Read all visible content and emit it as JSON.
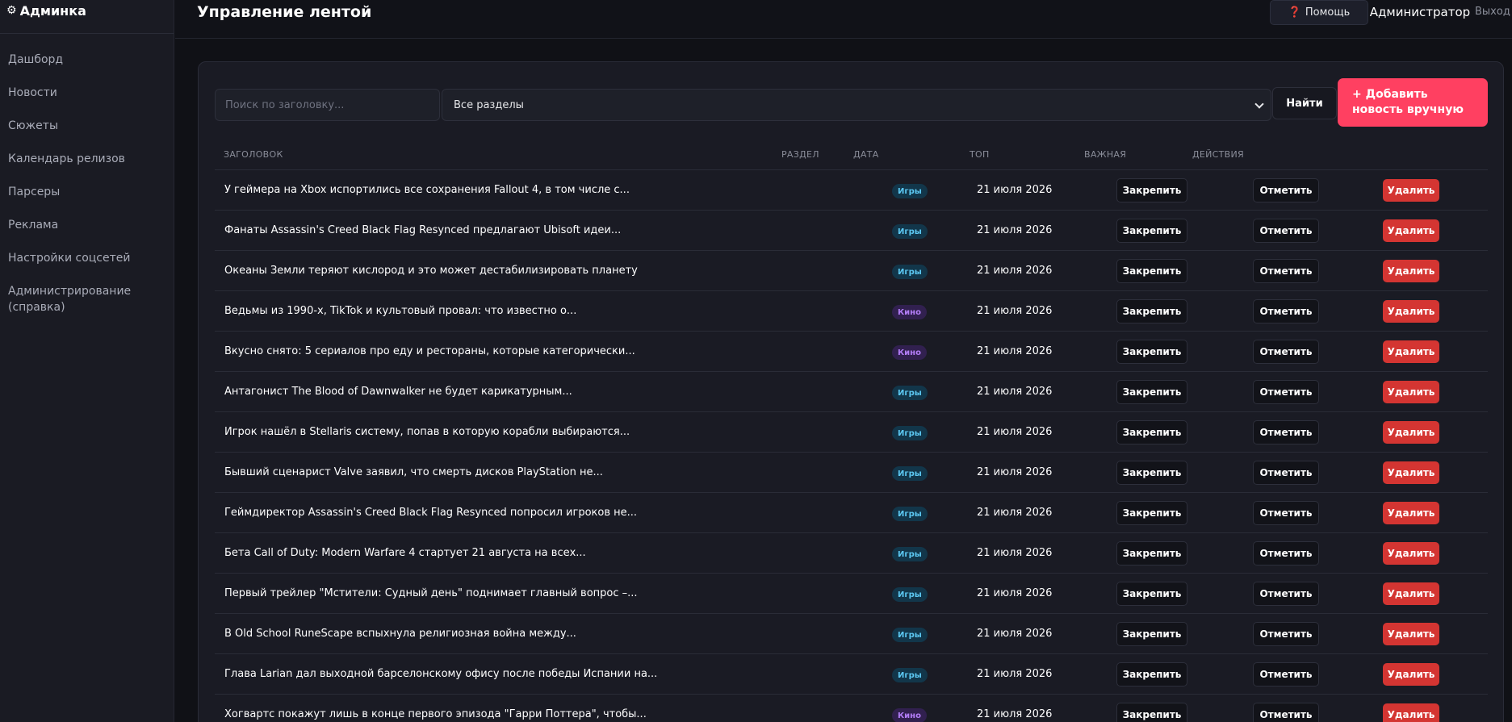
{
  "sidebar": {
    "brand": "Админка",
    "items": [
      "Дашборд",
      "Новости",
      "Сюжеты",
      "Календарь релизов",
      "Парсеры",
      "Реклама",
      "Настройки соцсетей",
      "Администрирование (справка)"
    ]
  },
  "header": {
    "title": "Управление лентой",
    "help_label": "Помощь",
    "user": "Администратор",
    "logout": "Выход"
  },
  "filters": {
    "search_placeholder": "Поиск по заголовку...",
    "section_selected": "Все разделы",
    "find_label": "Найти",
    "add_label": "+ Добавить новость вручную"
  },
  "table": {
    "columns": [
      "ЗАГОЛОВОК",
      "РАЗДЕЛ",
      "ДАТА",
      "ТОП",
      "ВАЖНАЯ",
      "ДЕЙСТВИЯ"
    ],
    "pin_label": "Закрепить",
    "mark_label": "Отметить",
    "delete_label": "Удалить",
    "rows": [
      {
        "title": "У геймера на Xbox испортились все сохранения Fallout 4, в том числе с...",
        "section": "Игры",
        "kind": "games",
        "date": "21 июля 2026"
      },
      {
        "title": "Фанаты Assassin's Creed Black Flag Resynced предлагают Ubisoft идеи...",
        "section": "Игры",
        "kind": "games",
        "date": "21 июля 2026"
      },
      {
        "title": "Океаны Земли теряют кислород и это может дестабилизировать планету",
        "section": "Игры",
        "kind": "games",
        "date": "21 июля 2026"
      },
      {
        "title": "Ведьмы из 1990-х, TikTok и культовый провал: что известно о...",
        "section": "Кино",
        "kind": "film",
        "date": "21 июля 2026"
      },
      {
        "title": "Вкусно снято: 5 сериалов про еду и рестораны, которые категорически...",
        "section": "Кино",
        "kind": "film",
        "date": "21 июля 2026"
      },
      {
        "title": "Антагонист The Blood of Dawnwalker не будет карикатурным...",
        "section": "Игры",
        "kind": "games",
        "date": "21 июля 2026"
      },
      {
        "title": "Игрок нашёл в Stellaris систему, попав в которую корабли выбираются...",
        "section": "Игры",
        "kind": "games",
        "date": "21 июля 2026"
      },
      {
        "title": "Бывший сценарист Valve заявил, что смерть дисков PlayStation не...",
        "section": "Игры",
        "kind": "games",
        "date": "21 июля 2026"
      },
      {
        "title": "Геймдиректор Assassin's Creed Black Flag Resynced попросил игроков не...",
        "section": "Игры",
        "kind": "games",
        "date": "21 июля 2026"
      },
      {
        "title": "Бета Call of Duty: Modern Warfare 4 стартует 21 августа на всех...",
        "section": "Игры",
        "kind": "games",
        "date": "21 июля 2026"
      },
      {
        "title": "Первый трейлер \"Мстители: Судный день\" поднимает главный вопрос –...",
        "section": "Игры",
        "kind": "games",
        "date": "21 июля 2026"
      },
      {
        "title": "В Old School RuneScape вспыхнула религиозная война между...",
        "section": "Игры",
        "kind": "games",
        "date": "21 июля 2026"
      },
      {
        "title": "Глава Larian дал выходной барселонскому офису после победы Испании на...",
        "section": "Игры",
        "kind": "games",
        "date": "21 июля 2026"
      },
      {
        "title": "Хогвартс покажут лишь в конце первого эпизода \"Гарри Поттера\", чтобы...",
        "section": "Кино",
        "kind": "film",
        "date": "21 июля 2026"
      }
    ]
  }
}
